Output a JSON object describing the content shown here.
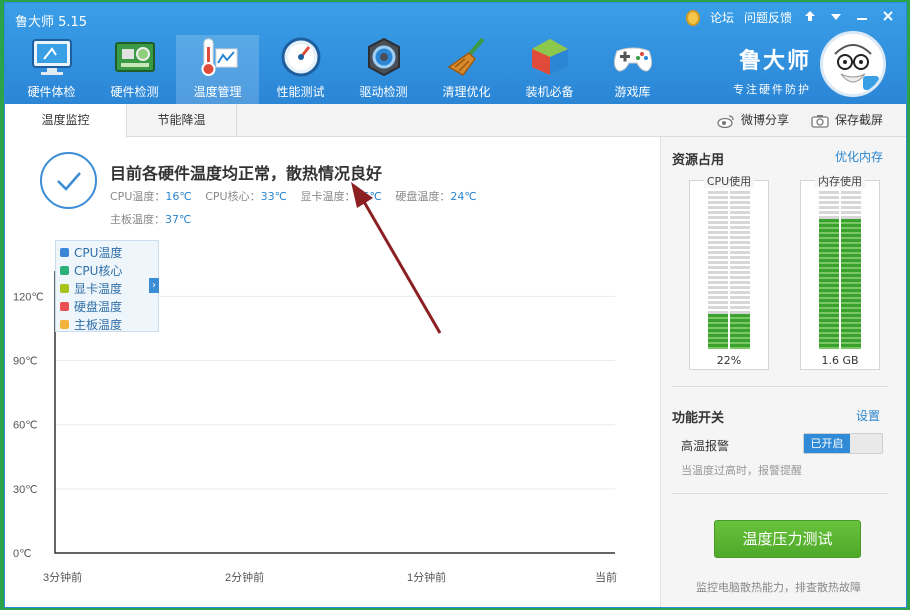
{
  "app": {
    "title": "鲁大师 5.15"
  },
  "top_links": {
    "forum": "论坛",
    "feedback": "问题反馈"
  },
  "nav": [
    {
      "label": "硬件体检",
      "icon": "monitor-icon"
    },
    {
      "label": "硬件检测",
      "icon": "motherboard-icon"
    },
    {
      "label": "温度管理",
      "icon": "thermometer-icon"
    },
    {
      "label": "性能测试",
      "icon": "speedometer-icon"
    },
    {
      "label": "驱动检测",
      "icon": "gear-icon"
    },
    {
      "label": "清理优化",
      "icon": "broom-icon"
    },
    {
      "label": "装机必备",
      "icon": "cube-icon"
    },
    {
      "label": "游戏库",
      "icon": "gamepad-icon"
    }
  ],
  "brand": {
    "name": "鲁大师",
    "slogan": "专注硬件防护"
  },
  "tabs": {
    "monitor": "温度监控",
    "power_save": "节能降温"
  },
  "share": {
    "weibo": "微博分享",
    "screenshot": "保存截屏"
  },
  "status": {
    "title": "目前各硬件温度均正常，散热情况良好",
    "items": [
      {
        "label": "CPU温度：",
        "value": "16℃"
      },
      {
        "label": "CPU核心：",
        "value": "33℃"
      },
      {
        "label": "显卡温度：",
        "value": "26℃"
      },
      {
        "label": "硬盘温度：",
        "value": "24℃"
      },
      {
        "label": "主板温度：",
        "value": "37℃"
      }
    ]
  },
  "chart_data": {
    "type": "line",
    "yticks": [
      "0℃",
      "30℃",
      "60℃",
      "90℃",
      "120℃"
    ],
    "xticks": [
      "3分钟前",
      "2分钟前",
      "1分钟前",
      "当前"
    ],
    "ylim": [
      0,
      130
    ],
    "grid": true,
    "legend_placement": "top-left",
    "series": [
      {
        "name": "CPU温度",
        "color": "#3b86d8",
        "values": []
      },
      {
        "name": "CPU核心",
        "color": "#2bb07a",
        "values": []
      },
      {
        "name": "显卡温度",
        "color": "#a8c41a",
        "values": []
      },
      {
        "name": "硬盘温度",
        "color": "#e8514f",
        "values": []
      },
      {
        "name": "主板温度",
        "color": "#f2b33a",
        "values": []
      }
    ]
  },
  "resources": {
    "title": "资源占用",
    "optimize_link": "优化内存",
    "cpu": {
      "label": "CPU使用",
      "value": "22%",
      "fraction": 0.22
    },
    "memory": {
      "label": "内存使用",
      "value": "1.6 GB",
      "fraction": 0.82
    }
  },
  "features": {
    "title": "功能开关",
    "settings_link": "设置",
    "alarm_label": "高温报警",
    "alarm_state": "已开启",
    "alarm_hint": "当温度过高时，报警提醒"
  },
  "stress_test": {
    "button": "温度压力测试",
    "hint": "监控电脑散热能力，排查散热故障"
  },
  "colors": {
    "accent": "#2b86d6",
    "green": "#4fa92a",
    "meter": "#3aa12f"
  }
}
